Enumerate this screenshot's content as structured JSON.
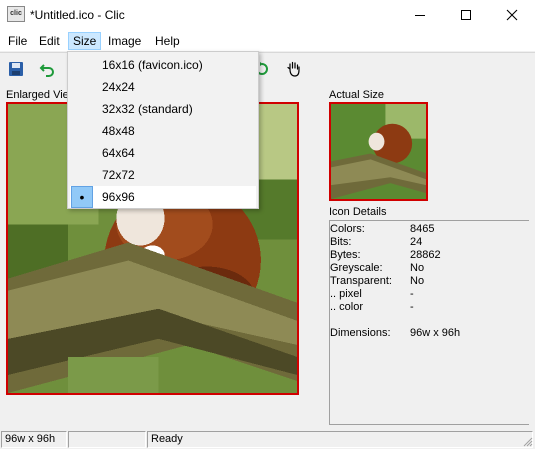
{
  "window": {
    "title": "*Untitled.ico - Clic",
    "app_icon_text": "clic",
    "buttons": {
      "minimize": "minimize",
      "maximize": "maximize",
      "close": "close"
    }
  },
  "menu": {
    "items": [
      {
        "label": "File"
      },
      {
        "label": "Edit"
      },
      {
        "label": "Size"
      },
      {
        "label": "Image"
      },
      {
        "label": "Help"
      }
    ],
    "active": "Size"
  },
  "toolbar": {
    "icons": [
      "save-icon",
      "undo-icon",
      "refresh-icon",
      "hand-icon"
    ]
  },
  "size_menu": {
    "options": [
      {
        "label": "16x16  (favicon.ico)"
      },
      {
        "label": "24x24"
      },
      {
        "label": "32x32  (standard)"
      },
      {
        "label": "48x48"
      },
      {
        "label": "64x64"
      },
      {
        "label": "72x72"
      },
      {
        "label": "96x96"
      }
    ],
    "selected": "96x96"
  },
  "enlarged_view": {
    "label": "Enlarged Vie"
  },
  "actual_size": {
    "label": "Actual Size"
  },
  "icon_details": {
    "header": "Icon Details",
    "rows": [
      {
        "key": "Colors:",
        "value": "8465"
      },
      {
        "key": "Bits:",
        "value": "24"
      },
      {
        "key": "Bytes:",
        "value": "28862"
      },
      {
        "key": "Greyscale:",
        "value": "No"
      },
      {
        "key": "Transparent:",
        "value": "No"
      },
      {
        "key": ".. pixel",
        "value": "-"
      },
      {
        "key": ".. color",
        "value": "-"
      },
      {
        "key": "Dimensions:",
        "value": "96w x 96h"
      }
    ]
  },
  "status": {
    "dimensions": "96w x 96h",
    "middle": "",
    "message": "Ready"
  },
  "colors": {
    "frame_border": "#d00000",
    "menu_active": "#cce8ff",
    "selected_check": "#91c9f7"
  }
}
